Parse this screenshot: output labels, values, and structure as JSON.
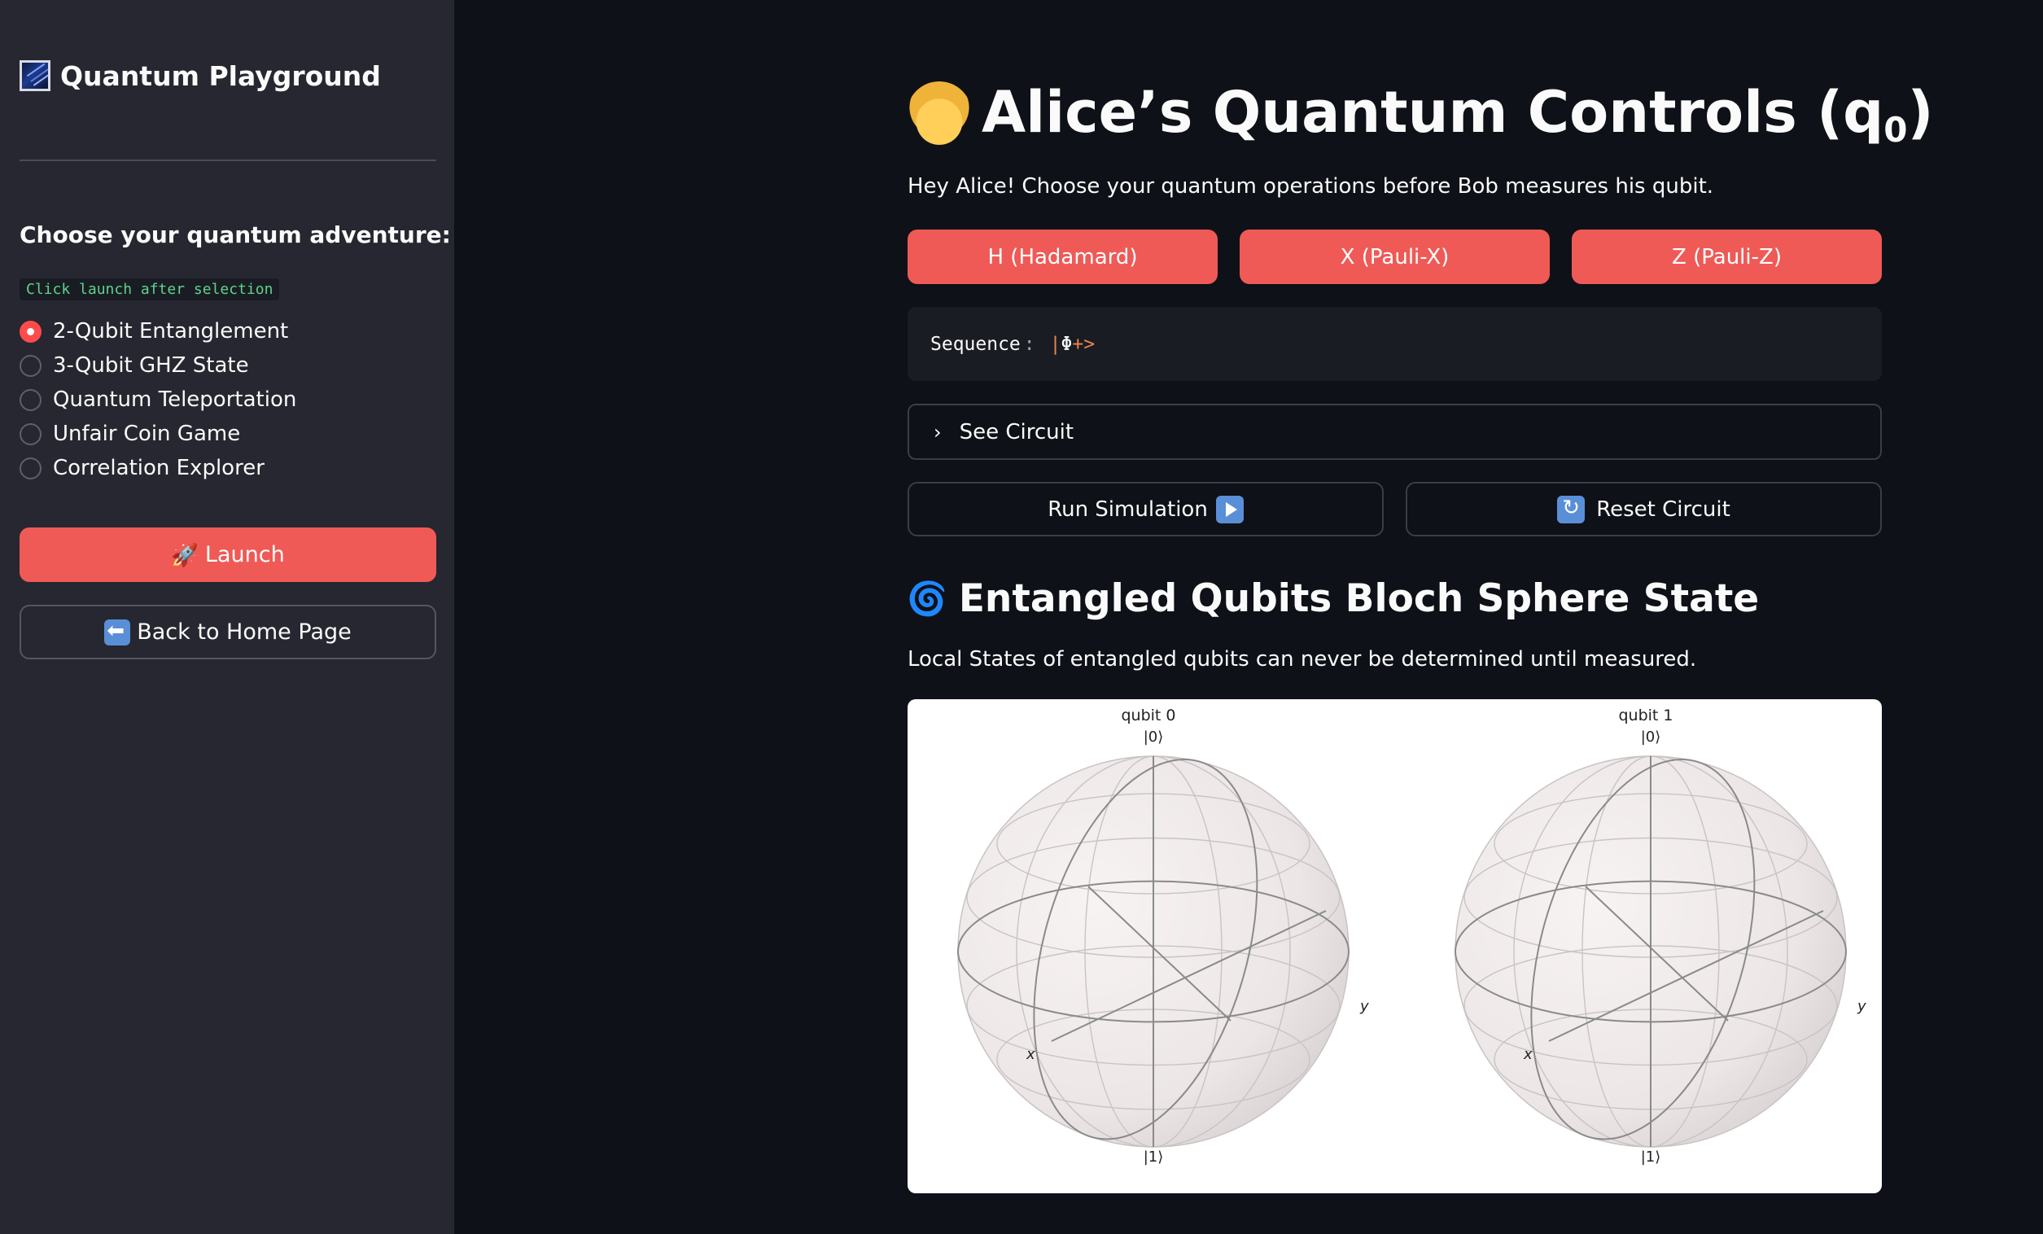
{
  "sidebar": {
    "app_title": "Quantum Playground",
    "adventure_heading": "Choose your quantum adventure:",
    "hint": "Click launch after selection",
    "options": [
      {
        "label": "2-Qubit Entanglement",
        "selected": true
      },
      {
        "label": "3-Qubit GHZ State",
        "selected": false
      },
      {
        "label": "Quantum Teleportation",
        "selected": false
      },
      {
        "label": "Unfair Coin Game",
        "selected": false
      },
      {
        "label": "Correlation Explorer",
        "selected": false
      }
    ],
    "launch_label": "Launch",
    "home_label": "Back to Home Page"
  },
  "main": {
    "title": "Alice’s Quantum Controls (q",
    "title_sub": "0",
    "title_close": ")",
    "intro": "Hey Alice! Choose your quantum operations before Bob measures his qubit.",
    "gates": [
      "H (Hadamard)",
      "X (Pauli-X)",
      "Z (Pauli-Z)"
    ],
    "sequence_label": "Sequence",
    "sequence_colon": ":",
    "sequence_bar": "|",
    "sequence_phi": "Φ",
    "sequence_tail": "+>",
    "see_circuit": "See Circuit",
    "run_label": "Run Simulation",
    "reset_label": "Reset Circuit",
    "section_title": "Entangled Qubits Bloch Sphere State",
    "section_desc": "Local States of entangled qubits can never be determined until measured."
  },
  "bloch": {
    "spheres": [
      {
        "title": "qubit 0",
        "top_label": "|0⟩",
        "bottom_label": "|1⟩",
        "x_label": "x",
        "y_label": "y"
      },
      {
        "title": "qubit 1",
        "top_label": "|0⟩",
        "bottom_label": "|1⟩",
        "x_label": "x",
        "y_label": "y"
      }
    ]
  },
  "colors": {
    "accent": "#ef5a56",
    "sidebar_bg": "#262730",
    "main_bg": "#0e1117"
  }
}
